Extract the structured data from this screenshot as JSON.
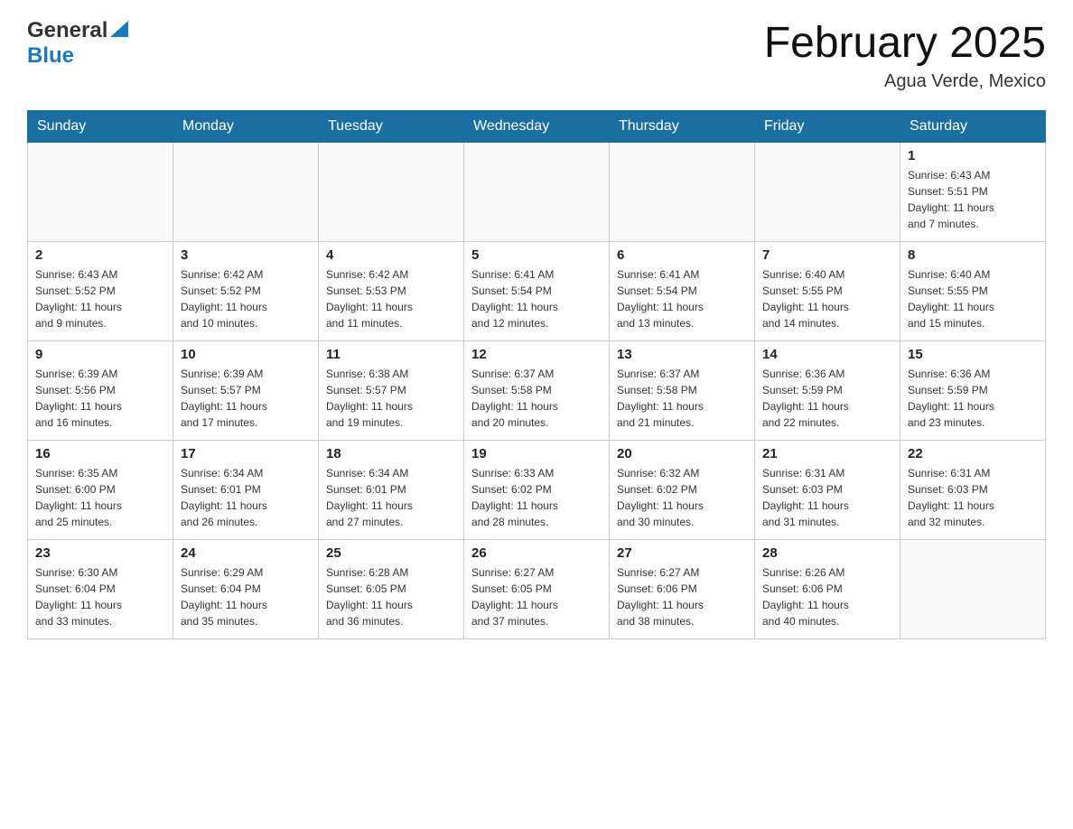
{
  "header": {
    "logo_line1": "General",
    "logo_line2": "Blue",
    "month_title": "February 2025",
    "location": "Agua Verde, Mexico"
  },
  "weekdays": [
    "Sunday",
    "Monday",
    "Tuesday",
    "Wednesday",
    "Thursday",
    "Friday",
    "Saturday"
  ],
  "weeks": [
    [
      {
        "day": "",
        "info": ""
      },
      {
        "day": "",
        "info": ""
      },
      {
        "day": "",
        "info": ""
      },
      {
        "day": "",
        "info": ""
      },
      {
        "day": "",
        "info": ""
      },
      {
        "day": "",
        "info": ""
      },
      {
        "day": "1",
        "info": "Sunrise: 6:43 AM\nSunset: 5:51 PM\nDaylight: 11 hours\nand 7 minutes."
      }
    ],
    [
      {
        "day": "2",
        "info": "Sunrise: 6:43 AM\nSunset: 5:52 PM\nDaylight: 11 hours\nand 9 minutes."
      },
      {
        "day": "3",
        "info": "Sunrise: 6:42 AM\nSunset: 5:52 PM\nDaylight: 11 hours\nand 10 minutes."
      },
      {
        "day": "4",
        "info": "Sunrise: 6:42 AM\nSunset: 5:53 PM\nDaylight: 11 hours\nand 11 minutes."
      },
      {
        "day": "5",
        "info": "Sunrise: 6:41 AM\nSunset: 5:54 PM\nDaylight: 11 hours\nand 12 minutes."
      },
      {
        "day": "6",
        "info": "Sunrise: 6:41 AM\nSunset: 5:54 PM\nDaylight: 11 hours\nand 13 minutes."
      },
      {
        "day": "7",
        "info": "Sunrise: 6:40 AM\nSunset: 5:55 PM\nDaylight: 11 hours\nand 14 minutes."
      },
      {
        "day": "8",
        "info": "Sunrise: 6:40 AM\nSunset: 5:55 PM\nDaylight: 11 hours\nand 15 minutes."
      }
    ],
    [
      {
        "day": "9",
        "info": "Sunrise: 6:39 AM\nSunset: 5:56 PM\nDaylight: 11 hours\nand 16 minutes."
      },
      {
        "day": "10",
        "info": "Sunrise: 6:39 AM\nSunset: 5:57 PM\nDaylight: 11 hours\nand 17 minutes."
      },
      {
        "day": "11",
        "info": "Sunrise: 6:38 AM\nSunset: 5:57 PM\nDaylight: 11 hours\nand 19 minutes."
      },
      {
        "day": "12",
        "info": "Sunrise: 6:37 AM\nSunset: 5:58 PM\nDaylight: 11 hours\nand 20 minutes."
      },
      {
        "day": "13",
        "info": "Sunrise: 6:37 AM\nSunset: 5:58 PM\nDaylight: 11 hours\nand 21 minutes."
      },
      {
        "day": "14",
        "info": "Sunrise: 6:36 AM\nSunset: 5:59 PM\nDaylight: 11 hours\nand 22 minutes."
      },
      {
        "day": "15",
        "info": "Sunrise: 6:36 AM\nSunset: 5:59 PM\nDaylight: 11 hours\nand 23 minutes."
      }
    ],
    [
      {
        "day": "16",
        "info": "Sunrise: 6:35 AM\nSunset: 6:00 PM\nDaylight: 11 hours\nand 25 minutes."
      },
      {
        "day": "17",
        "info": "Sunrise: 6:34 AM\nSunset: 6:01 PM\nDaylight: 11 hours\nand 26 minutes."
      },
      {
        "day": "18",
        "info": "Sunrise: 6:34 AM\nSunset: 6:01 PM\nDaylight: 11 hours\nand 27 minutes."
      },
      {
        "day": "19",
        "info": "Sunrise: 6:33 AM\nSunset: 6:02 PM\nDaylight: 11 hours\nand 28 minutes."
      },
      {
        "day": "20",
        "info": "Sunrise: 6:32 AM\nSunset: 6:02 PM\nDaylight: 11 hours\nand 30 minutes."
      },
      {
        "day": "21",
        "info": "Sunrise: 6:31 AM\nSunset: 6:03 PM\nDaylight: 11 hours\nand 31 minutes."
      },
      {
        "day": "22",
        "info": "Sunrise: 6:31 AM\nSunset: 6:03 PM\nDaylight: 11 hours\nand 32 minutes."
      }
    ],
    [
      {
        "day": "23",
        "info": "Sunrise: 6:30 AM\nSunset: 6:04 PM\nDaylight: 11 hours\nand 33 minutes."
      },
      {
        "day": "24",
        "info": "Sunrise: 6:29 AM\nSunset: 6:04 PM\nDaylight: 11 hours\nand 35 minutes."
      },
      {
        "day": "25",
        "info": "Sunrise: 6:28 AM\nSunset: 6:05 PM\nDaylight: 11 hours\nand 36 minutes."
      },
      {
        "day": "26",
        "info": "Sunrise: 6:27 AM\nSunset: 6:05 PM\nDaylight: 11 hours\nand 37 minutes."
      },
      {
        "day": "27",
        "info": "Sunrise: 6:27 AM\nSunset: 6:06 PM\nDaylight: 11 hours\nand 38 minutes."
      },
      {
        "day": "28",
        "info": "Sunrise: 6:26 AM\nSunset: 6:06 PM\nDaylight: 11 hours\nand 40 minutes."
      },
      {
        "day": "",
        "info": ""
      }
    ]
  ]
}
